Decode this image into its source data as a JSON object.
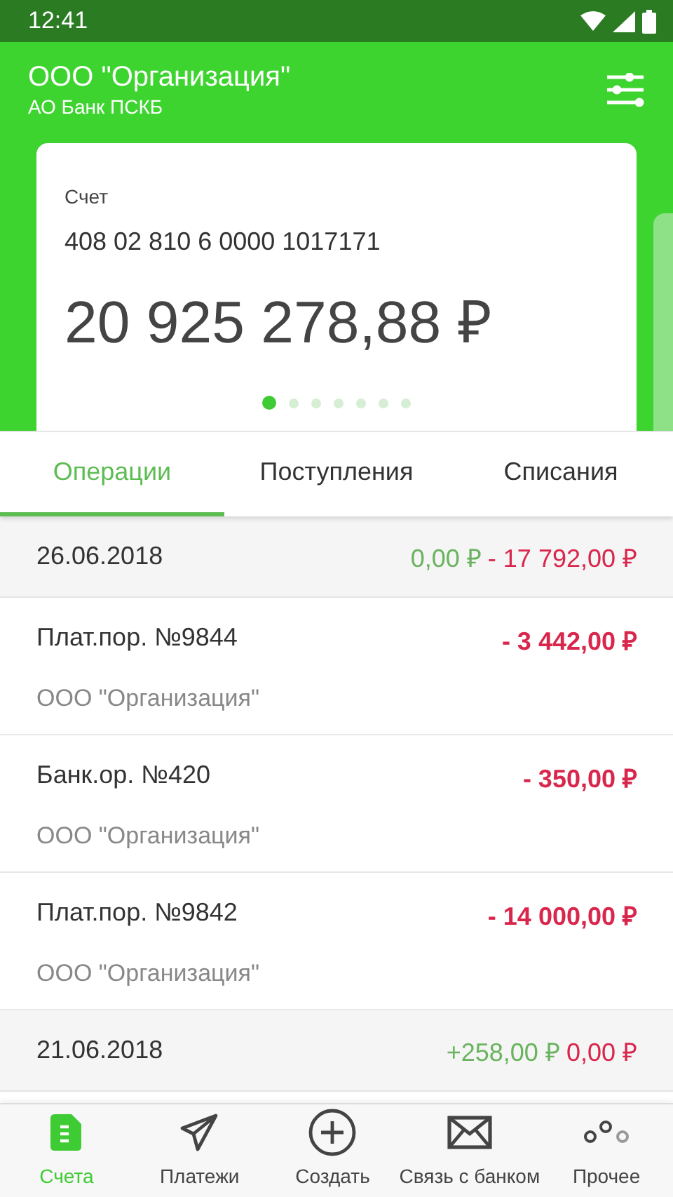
{
  "status_bar": {
    "time": "12:41"
  },
  "header": {
    "title": "ООО \"Организация\"",
    "subtitle": "АО Банк ПСКБ"
  },
  "account_card": {
    "label": "Счет",
    "number": "408 02 810 6 0000 1017171",
    "balance": "20 925 278,88 ₽"
  },
  "pager": [
    {
      "selected": true
    },
    {
      "selected": false
    },
    {
      "selected": false
    },
    {
      "selected": false
    },
    {
      "selected": false
    },
    {
      "selected": false
    },
    {
      "selected": false
    }
  ],
  "tabs": [
    {
      "label": "Операции",
      "selected": true
    },
    {
      "label": "Поступления",
      "selected": false
    },
    {
      "label": "Списания",
      "selected": false
    }
  ],
  "days": [
    {
      "date": "26.06.2018",
      "income": "0,00 ₽",
      "outcome": "- 17 792,00 ₽",
      "operations": [
        {
          "title": "Плат.пор. №9844",
          "counterparty": "ООО \"Организация\"",
          "amount": "- 3 442,00 ₽"
        },
        {
          "title": "Банк.ор. №420",
          "counterparty": "ООО \"Организация\"",
          "amount": "- 350,00 ₽"
        },
        {
          "title": "Плат.пор. №9842",
          "counterparty": "ООО \"Организация\"",
          "amount": "- 14 000,00 ₽"
        }
      ]
    },
    {
      "date": "21.06.2018",
      "income": "+258,00 ₽",
      "outcome": "0,00 ₽"
    }
  ],
  "bottom_nav": [
    {
      "kind": "accounts",
      "label": "Счета",
      "selected": true
    },
    {
      "kind": "payments",
      "label": "Платежи",
      "selected": false
    },
    {
      "kind": "create",
      "label": "Создать",
      "selected": false
    },
    {
      "kind": "mail",
      "label": "Связь с банком",
      "selected": false
    },
    {
      "kind": "more",
      "label": "Прочее",
      "selected": false
    }
  ]
}
